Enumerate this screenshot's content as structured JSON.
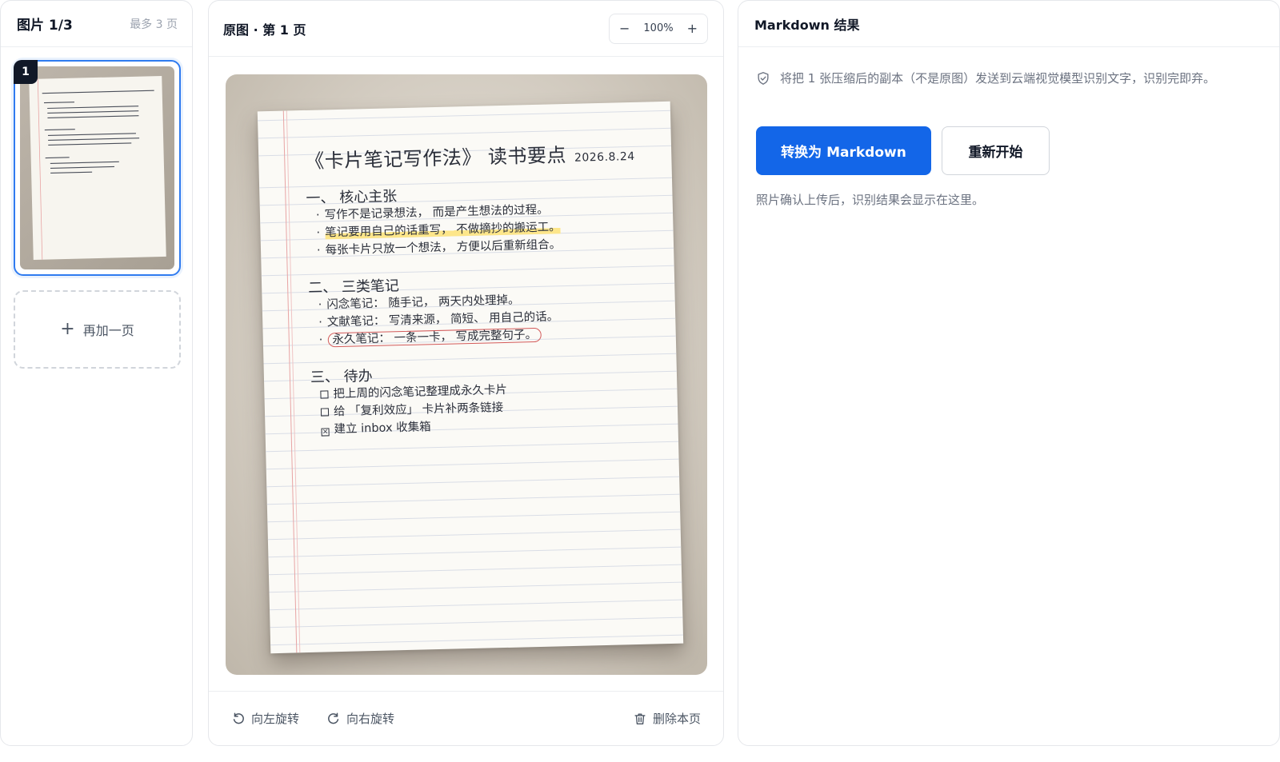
{
  "left": {
    "title": "图片 1/3",
    "max_pages": "最多 3 页",
    "thumb_badge": "1",
    "add_page": "再加一页"
  },
  "middle": {
    "title": "原图 · 第 1 页",
    "zoom": {
      "minus": "−",
      "value": "100%",
      "plus": "+"
    },
    "note": {
      "title": "《卡片笔记写作法》 读书要点",
      "date": "2026.8.24",
      "sections": [
        {
          "heading": "一、 核心主张",
          "items": [
            "写作不是记录想法， 而是产生想法的过程。",
            "笔记要用自己的话重写， 不做摘抄的搬运工。",
            "每张卡片只放一个想法， 方便以后重新组合。"
          ]
        },
        {
          "heading": "二、 三类笔记",
          "items": [
            "闪念笔记： 随手记， 两天内处理掉。",
            "文献笔记： 写清来源， 简短、 用自己的话。",
            "永久笔记： 一条一卡， 写成完整句子。"
          ]
        },
        {
          "heading": "三、 待办",
          "items": [
            "把上周的闪念笔记整理成永久卡片",
            "给 「复利效应」 卡片补两条链接",
            "建立 inbox 收集箱"
          ]
        }
      ]
    },
    "footer": {
      "rotate_left": "向左旋转",
      "rotate_right": "向右旋转",
      "delete_page": "删除本页"
    }
  },
  "right": {
    "title": "Markdown 结果",
    "notice": "将把 1 张压缩后的副本（不是原图）发送到云端视觉模型识别文字，识别完即弃。",
    "convert_button": "转换为 Markdown",
    "restart_button": "重新开始",
    "hint": "照片确认上传后，识别结果会显示在这里。"
  },
  "colors": {
    "accent": "#1366e8",
    "thumb_border": "#2f7bf0"
  }
}
